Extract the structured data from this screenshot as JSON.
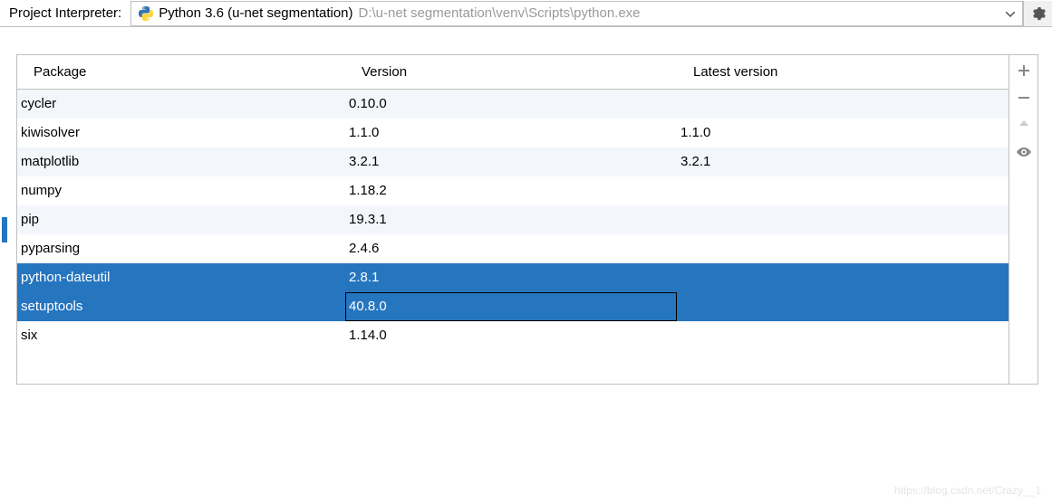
{
  "interpreter": {
    "label": "Project Interpreter:",
    "name": "Python 3.6 (u-net segmentation)",
    "path": "D:\\u-net segmentation\\venv\\Scripts\\python.exe"
  },
  "table": {
    "headers": {
      "package": "Package",
      "version": "Version",
      "latest": "Latest version"
    },
    "rows": [
      {
        "package": "cycler",
        "version": "0.10.0",
        "latest": ""
      },
      {
        "package": "kiwisolver",
        "version": "1.1.0",
        "latest": "1.1.0"
      },
      {
        "package": "matplotlib",
        "version": "3.2.1",
        "latest": "3.2.1"
      },
      {
        "package": "numpy",
        "version": "1.18.2",
        "latest": ""
      },
      {
        "package": "pip",
        "version": "19.3.1",
        "latest": ""
      },
      {
        "package": "pyparsing",
        "version": "2.4.6",
        "latest": ""
      },
      {
        "package": "python-dateutil",
        "version": "2.8.1",
        "latest": ""
      },
      {
        "package": "setuptools",
        "version": "40.8.0",
        "latest": ""
      },
      {
        "package": "six",
        "version": "1.14.0",
        "latest": ""
      }
    ]
  },
  "watermark": "https://blog.csdn.net/Crazy__1"
}
